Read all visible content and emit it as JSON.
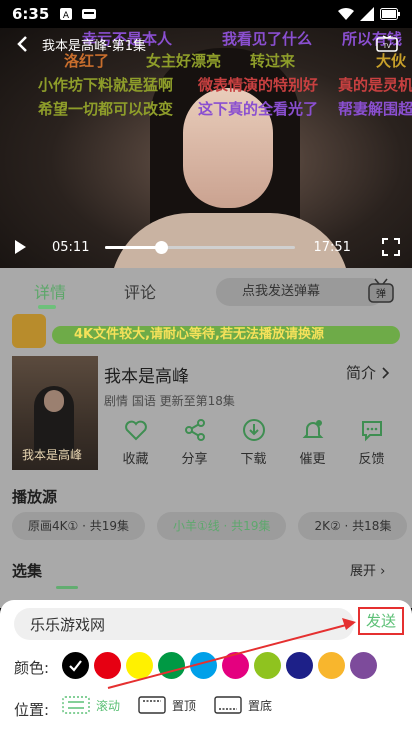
{
  "status_bar": {
    "time": "6:35"
  },
  "video": {
    "title": "我本是高峰-第1集",
    "current_time": "05:11",
    "total_time": "17:51",
    "progress": 0.29
  },
  "danmaku": [
    {
      "text": "幸亏不是本人",
      "color": "#8a4fd0"
    },
    {
      "text": "我看见了什么",
      "color": "#8a4fd0"
    },
    {
      "text": "所以有钱",
      "color": "#8a4fd0"
    },
    {
      "text": "洛红了",
      "color": "#c86e2d"
    },
    {
      "text": "女主好漂亮",
      "color": "#8e9d2a"
    },
    {
      "text": "转过来",
      "color": "#8e9d2a"
    },
    {
      "text": "大伙",
      "color": "#c8a02a"
    },
    {
      "text": "小作坊下料就是猛啊",
      "color": "#8e9d2a"
    },
    {
      "text": "微表情演的特别好",
      "color": "#c84040"
    },
    {
      "text": "真的是灵机",
      "color": "#c84040"
    },
    {
      "text": "希望一切都可以改变",
      "color": "#8e9d2a"
    },
    {
      "text": "这下真的全看光了",
      "color": "#8a4fd0"
    },
    {
      "text": "帮妻解围超",
      "color": "#8a4fd0"
    }
  ],
  "tabs": [
    {
      "label": "详情",
      "active": true
    },
    {
      "label": "评论",
      "active": false
    }
  ],
  "danmu_send_placeholder": "点我发送弹幕",
  "danmu_toggle_icon": "danmaku-toggle-icon",
  "notice": "4K文件较大,请耐心等待,若无法播放请换源",
  "show": {
    "poster_text": "我本是高峰",
    "title": "我本是高峰",
    "meta": "剧情 国语 更新至第18集",
    "intro_label": "简介"
  },
  "actions": [
    {
      "label": "收藏",
      "icon": "heart-icon"
    },
    {
      "label": "分享",
      "icon": "share-icon"
    },
    {
      "label": "下载",
      "icon": "download-icon"
    },
    {
      "label": "催更",
      "icon": "bell-icon"
    },
    {
      "label": "反馈",
      "icon": "feedback-icon"
    }
  ],
  "sources_title": "播放源",
  "sources": [
    {
      "label": "原画4K① · 共19集",
      "active": false
    },
    {
      "label": "小羊①线 · 共19集",
      "active": true
    },
    {
      "label": "2K② · 共18集",
      "active": false
    }
  ],
  "episodes_title": "选集",
  "expand_label": "展开",
  "panel": {
    "input_value": "乐乐游戏网",
    "send_label": "发送",
    "color_label": "颜色:",
    "position_label": "位置:",
    "colors": [
      "#000000",
      "#e60012",
      "#fff100",
      "#009944",
      "#00a0e9",
      "#e4007f",
      "#8fc31f",
      "#1d2088",
      "#f8b62d",
      "#7d4b9b"
    ],
    "selected_color": "#000000",
    "positions": [
      {
        "label": "滚动",
        "active": true
      },
      {
        "label": "置顶",
        "active": false
      },
      {
        "label": "置底",
        "active": false
      }
    ]
  },
  "accent_color": "#5cc076",
  "annotation_color": "#e53030"
}
